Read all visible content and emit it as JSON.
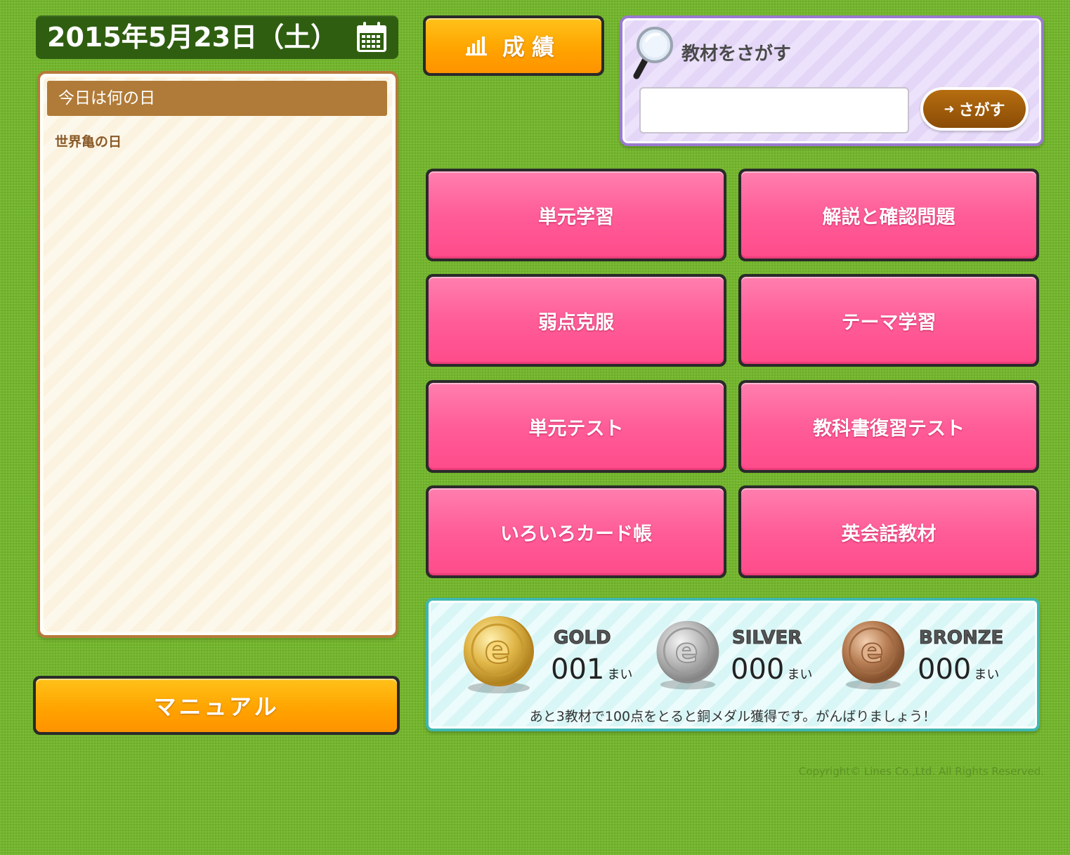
{
  "date": "2015年5月23日（土）",
  "info": {
    "header": "今日は何の日",
    "content": "世界亀の日"
  },
  "manual_label": "マニュアル",
  "grades_label": "成績",
  "search": {
    "title": "教材をさがす",
    "input_value": "",
    "button_label": "さがす"
  },
  "menu": [
    {
      "label": "単元学習"
    },
    {
      "label": "解説と確認問題"
    },
    {
      "label": "弱点克服"
    },
    {
      "label": "テーマ学習"
    },
    {
      "label": "単元テスト"
    },
    {
      "label": "教科書復習テスト"
    },
    {
      "label": "いろいろカード帳"
    },
    {
      "label": "英会話教材"
    }
  ],
  "medals": {
    "gold": {
      "label": "GOLD",
      "count": "001",
      "unit": "まい",
      "color": "#d8a93a"
    },
    "silver": {
      "label": "SILVER",
      "count": "000",
      "unit": "まい",
      "color": "#a9a9a9"
    },
    "bronze": {
      "label": "BRONZE",
      "count": "000",
      "unit": "まい",
      "color": "#b47c52"
    },
    "message": "あと3教材で100点をとると銅メダル獲得です。がんばりましょう！"
  },
  "copyright": "Copyright© Lines Co.,Ltd. All Rights Reserved."
}
